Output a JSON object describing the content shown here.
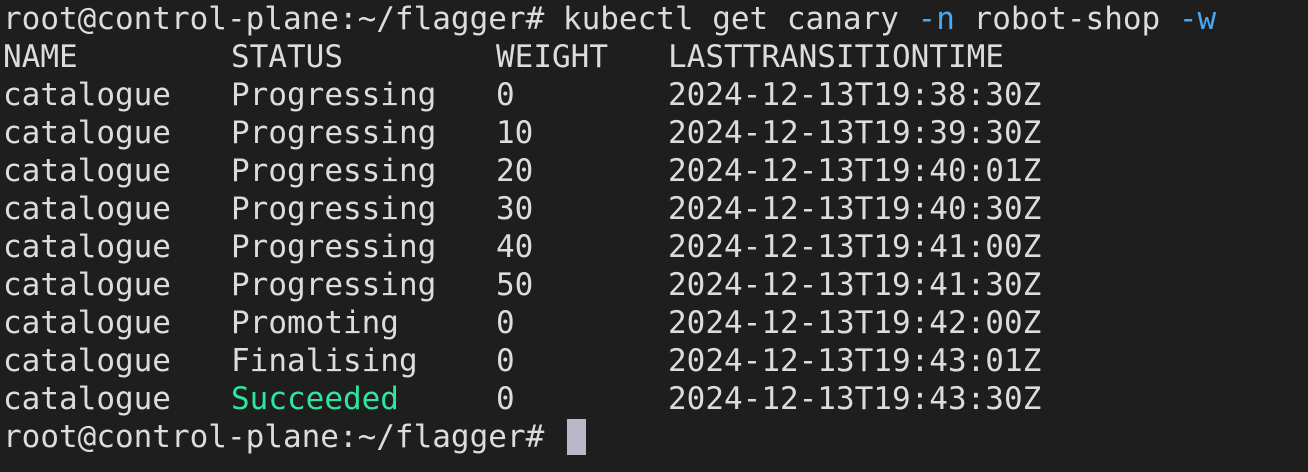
{
  "command_line": {
    "prompt": "root@control-plane:~/flagger#",
    "cmd_part1": "kubectl get canary",
    "flag_n": "-n",
    "namespace": "robot-shop",
    "flag_w": "-w"
  },
  "table": {
    "headers": [
      "NAME",
      "STATUS",
      "WEIGHT",
      "LASTTRANSITIONTIME"
    ],
    "rows": [
      {
        "name": "catalogue",
        "status": "Progressing",
        "weight": "0",
        "time": "2024-12-13T19:38:30Z"
      },
      {
        "name": "catalogue",
        "status": "Progressing",
        "weight": "10",
        "time": "2024-12-13T19:39:30Z"
      },
      {
        "name": "catalogue",
        "status": "Progressing",
        "weight": "20",
        "time": "2024-12-13T19:40:01Z"
      },
      {
        "name": "catalogue",
        "status": "Progressing",
        "weight": "30",
        "time": "2024-12-13T19:40:30Z"
      },
      {
        "name": "catalogue",
        "status": "Progressing",
        "weight": "40",
        "time": "2024-12-13T19:41:00Z"
      },
      {
        "name": "catalogue",
        "status": "Progressing",
        "weight": "50",
        "time": "2024-12-13T19:41:30Z"
      },
      {
        "name": "catalogue",
        "status": "Promoting",
        "weight": "0",
        "time": "2024-12-13T19:42:00Z"
      },
      {
        "name": "catalogue",
        "status": "Finalising",
        "weight": "0",
        "time": "2024-12-13T19:43:01Z"
      },
      {
        "name": "catalogue",
        "status": "Succeeded",
        "weight": "0",
        "time": "2024-12-13T19:43:30Z"
      }
    ]
  },
  "final_prompt": "root@control-plane:~/flagger#",
  "colors": {
    "background": "#1e1e1e",
    "text": "#dcdcdc",
    "flag": "#4aa8f0",
    "succeeded": "#2ee6a0",
    "cursor": "#b8b8c8"
  }
}
